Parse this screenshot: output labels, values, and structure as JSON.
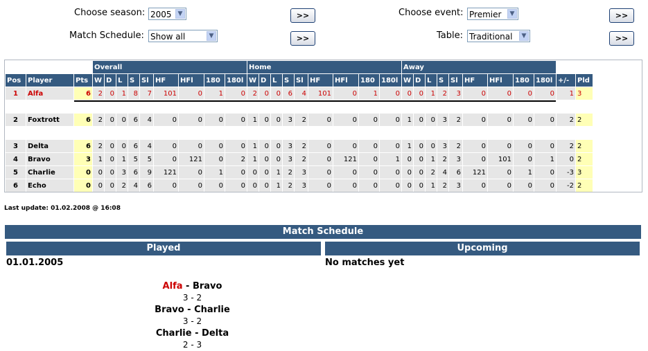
{
  "controls": {
    "season_label": "Choose season:",
    "season_value": "2005",
    "event_label": "Choose event:",
    "event_value": "Premier",
    "schedule_label": "Match Schedule:",
    "schedule_value": "Show all",
    "table_label": "Table:",
    "table_value": "Traditional",
    "go_label": ">>"
  },
  "standings": {
    "group_headers": [
      "Overall",
      "Home",
      "Away"
    ],
    "columns": [
      "Pos",
      "Player",
      "Pts",
      "W",
      "D",
      "L",
      "S",
      "Sl",
      "HF",
      "HFl",
      "180",
      "180l",
      "W",
      "D",
      "L",
      "S",
      "Sl",
      "HF",
      "HFl",
      "180",
      "180l",
      "W",
      "D",
      "L",
      "S",
      "Sl",
      "HF",
      "HFl",
      "180",
      "180l",
      "+/-",
      "Pld"
    ],
    "rows": [
      {
        "cells": [
          "1",
          "Alfa",
          "6",
          "2",
          "0",
          "1",
          "8",
          "7",
          "101",
          "0",
          "1",
          "0",
          "2",
          "0",
          "0",
          "6",
          "4",
          "101",
          "0",
          "1",
          "0",
          "0",
          "0",
          "1",
          "2",
          "3",
          "0",
          "0",
          "0",
          "0",
          "1",
          "3"
        ]
      },
      {
        "cells": [
          "2",
          "Foxtrott",
          "6",
          "2",
          "0",
          "0",
          "6",
          "4",
          "0",
          "0",
          "0",
          "0",
          "1",
          "0",
          "0",
          "3",
          "2",
          "0",
          "0",
          "0",
          "0",
          "1",
          "0",
          "0",
          "3",
          "2",
          "0",
          "0",
          "0",
          "0",
          "2",
          "2"
        ]
      },
      {
        "cells": [
          "3",
          "Delta",
          "6",
          "2",
          "0",
          "0",
          "6",
          "4",
          "0",
          "0",
          "0",
          "0",
          "1",
          "0",
          "0",
          "3",
          "2",
          "0",
          "0",
          "0",
          "0",
          "1",
          "0",
          "0",
          "3",
          "2",
          "0",
          "0",
          "0",
          "0",
          "2",
          "2"
        ]
      },
      {
        "cells": [
          "4",
          "Bravo",
          "3",
          "1",
          "0",
          "1",
          "5",
          "5",
          "0",
          "121",
          "0",
          "2",
          "1",
          "0",
          "0",
          "3",
          "2",
          "0",
          "121",
          "0",
          "1",
          "0",
          "0",
          "1",
          "2",
          "3",
          "0",
          "101",
          "0",
          "1",
          "0",
          "2"
        ]
      },
      {
        "cells": [
          "5",
          "Charlie",
          "0",
          "0",
          "0",
          "3",
          "6",
          "9",
          "121",
          "0",
          "1",
          "0",
          "0",
          "0",
          "1",
          "2",
          "3",
          "0",
          "0",
          "0",
          "0",
          "0",
          "0",
          "2",
          "4",
          "6",
          "121",
          "0",
          "1",
          "0",
          "-3",
          "3"
        ]
      },
      {
        "cells": [
          "6",
          "Echo",
          "0",
          "0",
          "0",
          "2",
          "4",
          "6",
          "0",
          "0",
          "0",
          "0",
          "0",
          "0",
          "1",
          "2",
          "3",
          "0",
          "0",
          "0",
          "0",
          "0",
          "0",
          "1",
          "2",
          "3",
          "0",
          "0",
          "0",
          "0",
          "-2",
          "2"
        ]
      }
    ]
  },
  "last_update": "Last update: 01.02.2008 @ 16:08",
  "schedule": {
    "title": "Match Schedule",
    "played_label": "Played",
    "upcoming_label": "Upcoming",
    "date": "01.01.2005",
    "upcoming_text": "No matches yet",
    "matches": [
      {
        "home": "Alfa",
        "sep": " - ",
        "away": "Bravo",
        "score": "3 - 2",
        "home_color": "#cc0000"
      },
      {
        "home": "Bravo",
        "sep": " - ",
        "away": "Charlie",
        "score": "3 - 2",
        "home_color": "#000000"
      },
      {
        "home": "Charlie",
        "sep": " - ",
        "away": "Delta",
        "score": "2 - 3",
        "home_color": "#000000"
      }
    ]
  },
  "colors": {
    "header_bg": "#355a80",
    "highlight": "#cc0000",
    "pts_bg": "#ffffb6",
    "row_bg": "#e6e6e6"
  }
}
